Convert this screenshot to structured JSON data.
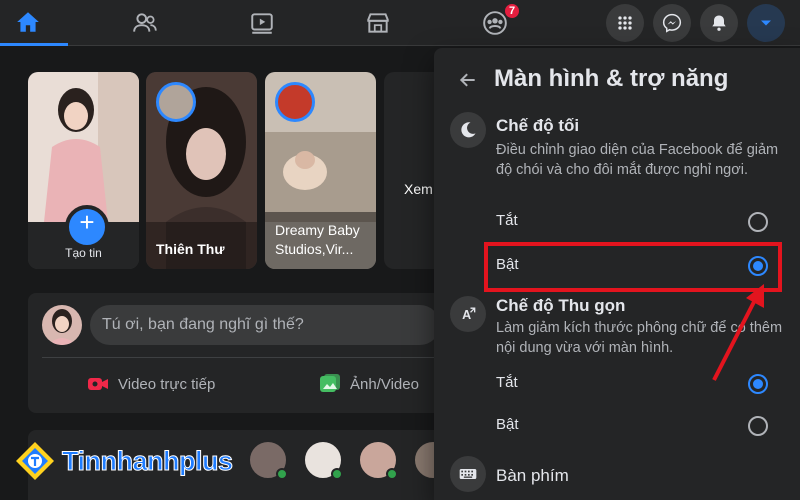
{
  "topbar": {
    "tabs": [
      {
        "id": "home",
        "active": true
      },
      {
        "id": "friends",
        "active": false
      },
      {
        "id": "watch",
        "active": false
      },
      {
        "id": "marketplace",
        "active": false
      },
      {
        "id": "groups",
        "active": false,
        "badge": "7"
      }
    ],
    "actions": [
      "menu-grid",
      "messenger",
      "notifications",
      "account"
    ]
  },
  "stories": {
    "create_label": "Tạo tin",
    "items": [
      {
        "name": "Thiên Thư"
      },
      {
        "name": "Dreamy Baby Studios,Vir..."
      }
    ],
    "see_all_partial": "Xem"
  },
  "composer": {
    "placeholder": "Tú ơi, bạn đang nghĩ gì thế?",
    "live_label": "Video trực tiếp",
    "photo_label": "Ảnh/Video"
  },
  "watermark": {
    "text": "Tinnhanhplus"
  },
  "panel": {
    "title": "Màn hình & trợ năng",
    "dark_mode": {
      "title": "Chế độ tối",
      "desc": "Điều chỉnh giao diện của Facebook để giảm độ chói và cho đôi mắt được nghỉ ngơi.",
      "off_label": "Tắt",
      "on_label": "Bật",
      "selected": "on"
    },
    "compact_mode": {
      "title": "Chế độ Thu gọn",
      "desc": "Làm giảm kích thước phông chữ để có thêm nội dung vừa với màn hình.",
      "off_label": "Tắt",
      "on_label": "Bật",
      "selected": "off"
    },
    "keyboard": {
      "title": "Bàn phím"
    }
  },
  "colors": {
    "accent": "#2d88ff",
    "background": "#18191a",
    "surface": "#242526",
    "highlight": "#e3141e"
  }
}
